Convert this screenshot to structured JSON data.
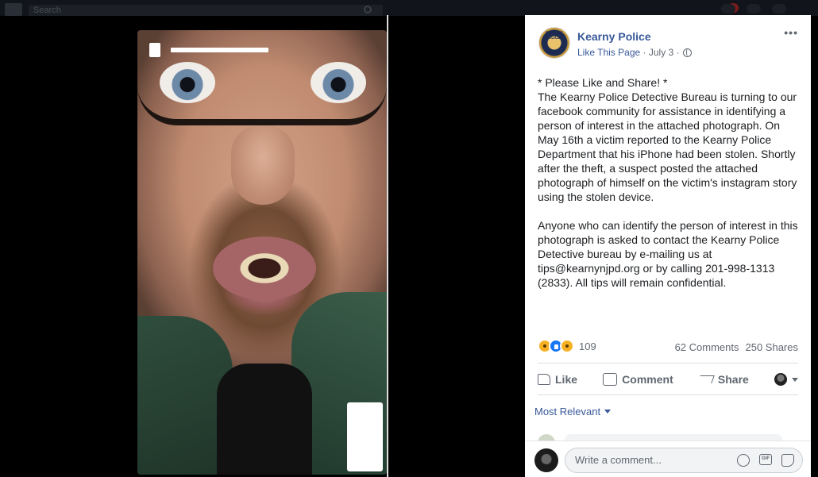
{
  "topbar": {
    "search_placeholder": "Search",
    "notif_count": "2"
  },
  "post": {
    "page_name": "Kearny Police",
    "badge_text": "KEARNY POLICE",
    "like_link": "Like This Page",
    "date": "July 3",
    "separator": "·",
    "paragraphs": [
      "* Please Like and Share! *\nThe Kearny Police Detective Bureau is turning to our facebook community for assistance in identifying a person of interest in the attached photograph. On May 16th a victim reported to the Kearny Police Department that his iPhone had been stolen. Shortly after the theft, a suspect posted the attached photograph of himself on the victim's instagram story using the stolen device.",
      "Anyone who can identify the person of interest in this photograph is asked to contact the Kearny Police Detective bureau by e-mailing us at tips@kearnynjpd.org or by calling 201-998-1313 (2833). All tips will remain confidential."
    ],
    "reaction_count": "109",
    "comments_count": "62 Comments",
    "shares_count": "250 Shares"
  },
  "actions": {
    "like": "Like",
    "comment": "Comment",
    "share": "Share"
  },
  "comments": {
    "sort_label": "Most Relevant",
    "placeholder": "Write a comment...",
    "gif_label": "GIF"
  },
  "icons": [
    "more-icon",
    "globe-icon",
    "thumb-icon",
    "comment-icon",
    "share-icon",
    "emoji-icon",
    "gif-icon",
    "sticker-icon",
    "search-icon"
  ],
  "colors": {
    "link": "#385898",
    "text": "#1c1e21",
    "muted": "#606770",
    "like_blue": "#1877f2"
  }
}
